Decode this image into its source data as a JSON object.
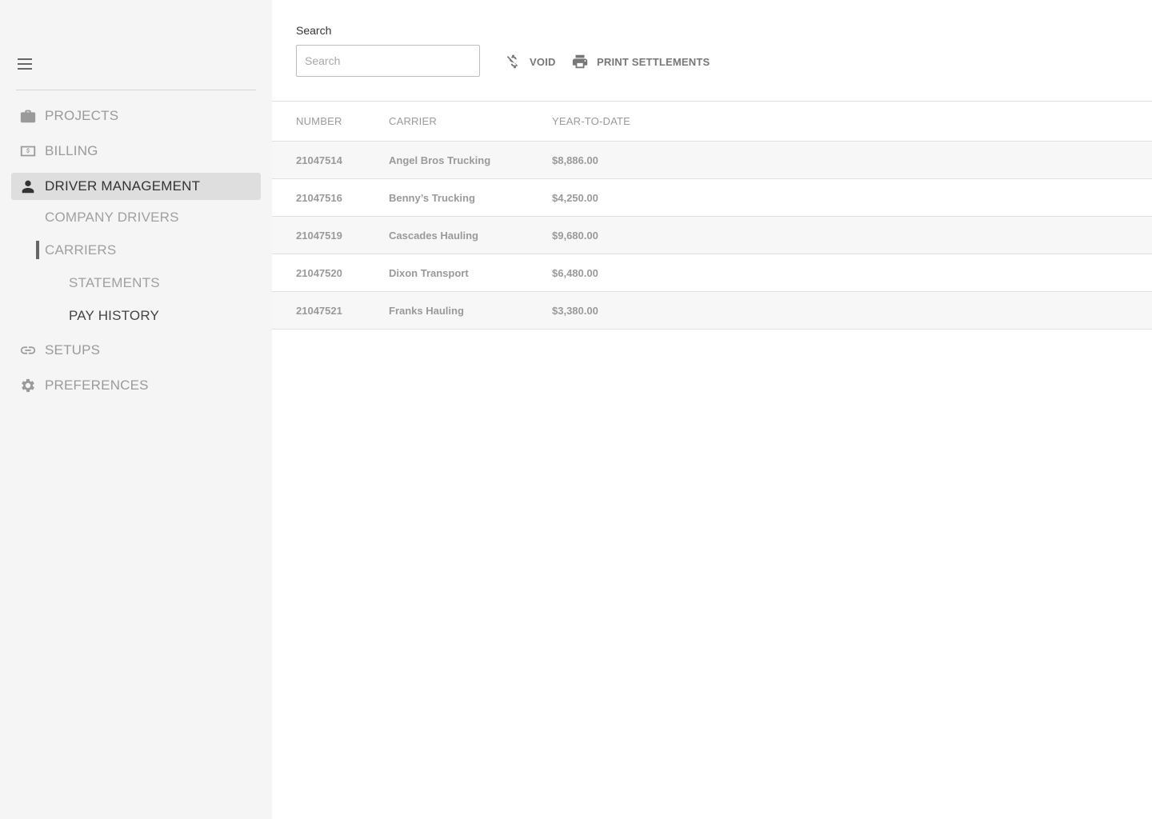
{
  "sidebar": {
    "nav": [
      {
        "label": "PROJECTS",
        "icon": "briefcase-icon"
      },
      {
        "label": "BILLING",
        "icon": "money-icon"
      },
      {
        "label": "DRIVER MANAGEMENT",
        "icon": "person-icon"
      },
      {
        "label": "SETUPS",
        "icon": "link-icon"
      },
      {
        "label": "PREFERENCES",
        "icon": "gear-icon"
      }
    ],
    "sub": {
      "company_drivers": "COMPANY DRIVERS",
      "carriers": "CARRIERS",
      "statements": "STATEMENTS",
      "pay_history": "PAY HISTORY"
    }
  },
  "toolbar": {
    "search_label": "Search",
    "search_placeholder": "Search",
    "search_value": "",
    "void_label": "VOID",
    "print_label": "PRINT SETTLEMENTS"
  },
  "table": {
    "columns": [
      "NUMBER",
      "CARRIER",
      "YEAR-TO-DATE"
    ],
    "rows": [
      {
        "number": "21047514",
        "carrier": "Angel Bros Trucking",
        "ytd": "$8,886.00"
      },
      {
        "number": "21047516",
        "carrier": "Benny’s Trucking",
        "ytd": "$4,250.00"
      },
      {
        "number": "21047519",
        "carrier": "Cascades Hauling",
        "ytd": "$9,680.00"
      },
      {
        "number": "21047520",
        "carrier": "Dixon Transport",
        "ytd": "$6,480.00"
      },
      {
        "number": "21047521",
        "carrier": "Franks Hauling",
        "ytd": "$3,380.00"
      }
    ]
  },
  "colors": {
    "sidebar_bg": "#f5f5f5",
    "active_bg": "#dedede",
    "muted_text": "#9a9a9a",
    "dark_text": "#333333"
  }
}
